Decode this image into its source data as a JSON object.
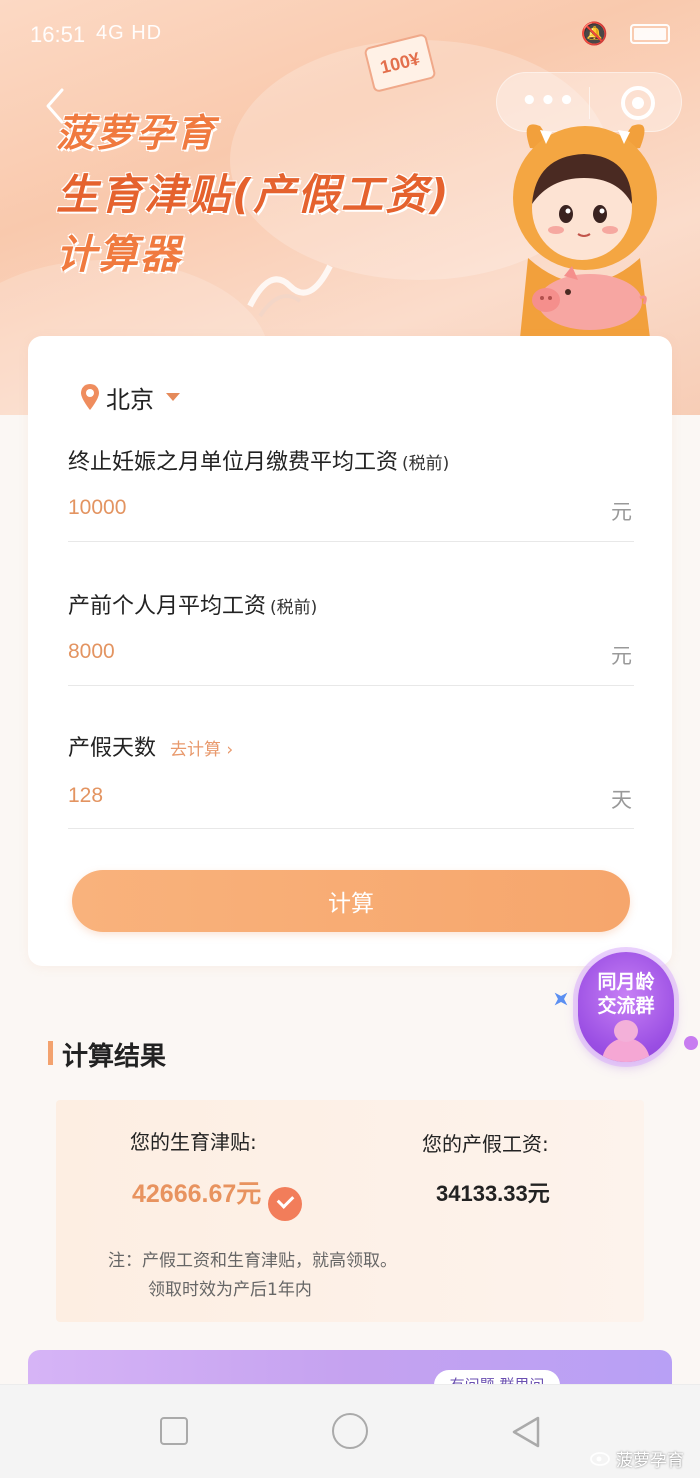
{
  "status_bar": {
    "time": "16:51",
    "network": "4G HD"
  },
  "header": {
    "ticket_text": "100¥",
    "title_line1": "菠萝孕育",
    "title_line2": "生育津贴(产假工资)",
    "title_line3": "计算器"
  },
  "form": {
    "city": "北京",
    "salary_label": "终止妊娠之月单位月缴费平均工资",
    "salary_note": "(税前)",
    "salary_value": "10000",
    "salary_unit": "元",
    "personal_label": "产前个人月平均工资",
    "personal_note": "(税前)",
    "personal_value": "8000",
    "personal_unit": "元",
    "days_label": "产假天数",
    "days_link": "去计算 ›",
    "days_value": "128",
    "days_unit": "天",
    "calc_button": "计算"
  },
  "float_badge": {
    "line1": "同月龄",
    "line2": "交流群"
  },
  "result": {
    "title": "计算结果",
    "allowance_label": "您的生育津贴:",
    "allowance_value": "42666.67元",
    "wage_label": "您的产假工资:",
    "wage_value": "34133.33元",
    "note_line1": "注：产假工资和生育津贴，就高领取。",
    "note_line2": "领取时效为产后1年内"
  },
  "promo": {
    "tag": "有问题 群里问"
  },
  "watermark": "菠萝孕育",
  "colors": {
    "accent": "#e39461",
    "button": "#f6a66c",
    "allowance": "#e8935f",
    "title": "#e5622e"
  }
}
